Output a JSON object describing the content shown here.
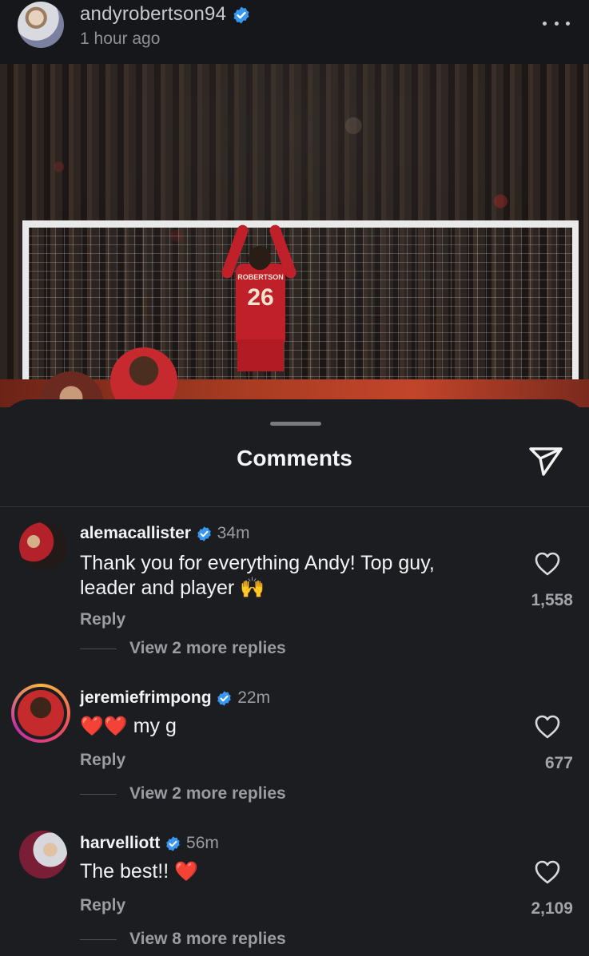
{
  "post": {
    "username": "andyrobertson94",
    "time": "1 hour ago",
    "jersey_name": "ROBERTSON",
    "jersey_number": "26"
  },
  "sheet": {
    "title": "Comments"
  },
  "comments": [
    {
      "username": "alemacallister",
      "time": "34m",
      "text": "Thank you for everything Andy! Top guy, leader and player 🙌",
      "reply_label": "Reply",
      "view_replies": "View 2 more replies",
      "likes": "1,558"
    },
    {
      "username": "jeremiefrimpong",
      "time": "22m",
      "text_emoji": "❤️❤️",
      "text": "my g",
      "reply_label": "Reply",
      "view_replies": "View 2 more replies",
      "likes": "677"
    },
    {
      "username": "harvelliott",
      "time": "56m",
      "text": "The best!!",
      "text_emoji": "❤️",
      "reply_label": "Reply",
      "view_replies": "View 8 more replies",
      "likes": "2,109"
    }
  ],
  "icons": {
    "verified": "verified-badge-icon",
    "more": "more-options-icon",
    "share": "share-icon",
    "heart": "heart-outline-icon"
  },
  "colors": {
    "verified_blue": "#3897f0",
    "sheet_bg": "#1c1d20",
    "muted_text": "#9a9ca1"
  }
}
